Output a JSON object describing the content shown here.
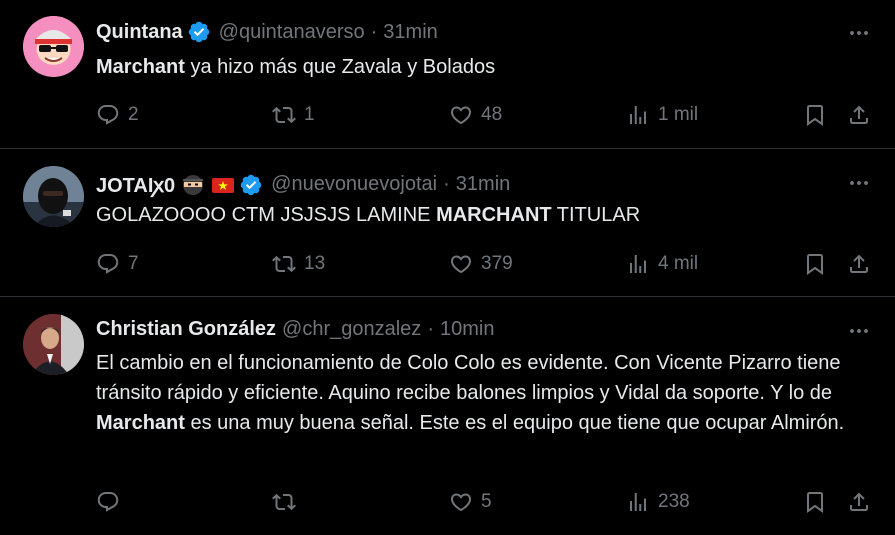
{
  "tweets": [
    {
      "name": "Quintana",
      "handle": "@quintanaverso",
      "dot": "·",
      "time": "31min",
      "text_bold_1": "Marchant",
      "text_rest_1": " ya hizo más que Zavala y Bolados",
      "replies": "2",
      "retweets": "1",
      "likes": "48",
      "views": "1 mil"
    },
    {
      "name": "JOTAIꭗ0",
      "handle": "@nuevonuevojotai",
      "dot": "·",
      "time": "31min",
      "text_pre": "GOLAZOOOO CTM JSJSJS LAMINE ",
      "text_bold_1": "MARCHANT",
      "text_rest_1": " TITULAR",
      "replies": "7",
      "retweets": "13",
      "likes": "379",
      "views": "4 mil"
    },
    {
      "name": "Christian González",
      "handle": "@chr_gonzalez",
      "dot": "·",
      "time": "10min",
      "text_pre": "El cambio en el funcionamiento de Colo Colo es evidente. Con Vicente Pizarro tiene tránsito rápido y eficiente. Aquino recibe balones limpios y Vidal da soporte. Y lo de ",
      "text_bold_1": "Marchant",
      "text_rest_1": " es una muy buena señal. Este es el equipo que tiene que ocupar Almirón.",
      "replies": "",
      "retweets": "",
      "likes": "5",
      "views": "238"
    }
  ],
  "icons": {
    "verified": "verified-badge-icon",
    "more": "more-options-icon",
    "reply": "reply-icon",
    "retweet": "retweet-icon",
    "like": "heart-icon",
    "views": "views-chart-icon",
    "bookmark": "bookmark-icon",
    "share": "share-icon"
  },
  "colors": {
    "background": "#000000",
    "text": "#e7e9ea",
    "muted": "#71767b",
    "divider": "#2f3336",
    "verified": "#1d9bf0"
  }
}
